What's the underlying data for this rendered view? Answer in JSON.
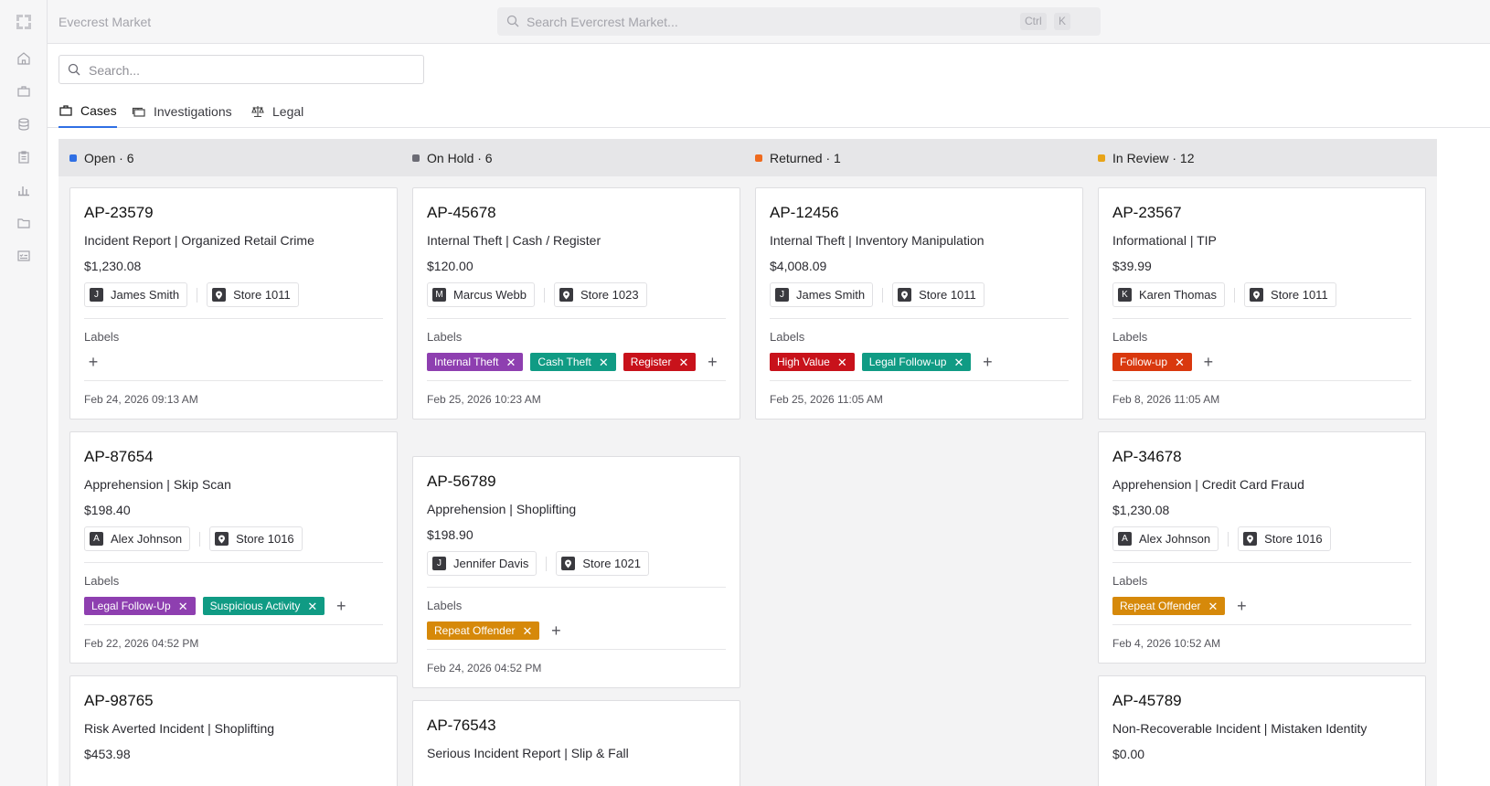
{
  "app": {
    "brand": "Evecrest Market"
  },
  "global_search": {
    "placeholder": "Search Evercrest Market...",
    "key1": "Ctrl",
    "key2": "K"
  },
  "local_search": {
    "placeholder": "Search..."
  },
  "tabs": [
    {
      "label": "Cases",
      "icon": "briefcase-icon"
    },
    {
      "label": "Investigations",
      "icon": "stack-briefcase-icon"
    },
    {
      "label": "Legal",
      "icon": "scale-icon"
    }
  ],
  "labels_heading": "Labels",
  "colors": {
    "accent": "#2f6fe4",
    "open": "#2f6fe4",
    "on_hold": "#6b6b74",
    "returned": "#ef6a1e",
    "in_review": "#e8a418"
  },
  "columns": [
    {
      "title": "Open · 6",
      "cards": [
        {
          "id": "AP-23579",
          "title": "Incident Report | Organized Retail Crime",
          "amount": "$1,230.08",
          "user_initial": "J",
          "user": "James Smith",
          "store": "Store 1011",
          "labels": [],
          "date": "Feb 24, 2026 09:13 AM"
        },
        {
          "id": "AP-87654",
          "title": "Apprehension | Skip Scan",
          "amount": "$198.40",
          "user_initial": "A",
          "user": "Alex Johnson",
          "store": "Store 1016",
          "labels": [
            {
              "text": "Legal Follow-Up",
              "color": "#8e3fb0"
            },
            {
              "text": "Suspicious Activity",
              "color": "#109b84"
            }
          ],
          "date": "Feb 22, 2026 04:52 PM"
        },
        {
          "id": "AP-98765",
          "title": "Risk Averted Incident | Shoplifting",
          "amount": "$453.98"
        }
      ]
    },
    {
      "title": "On Hold · 6",
      "cards": [
        {
          "id": "AP-45678",
          "title": "Internal Theft | Cash / Register",
          "amount": "$120.00",
          "user_initial": "M",
          "user": "Marcus Webb",
          "store": "Store 1023",
          "labels": [
            {
              "text": "Internal Theft",
              "color": "#8e3fb0"
            },
            {
              "text": "Cash Theft",
              "color": "#109b84"
            },
            {
              "text": "Register",
              "color": "#c8121b"
            }
          ],
          "wrap_plus": true,
          "date": "Feb 25, 2026 10:23 AM"
        },
        {
          "id": "AP-56789",
          "title": "Apprehension | Shoplifting",
          "amount": "$198.90",
          "user_initial": "J",
          "user": "Jennifer Davis",
          "store": "Store 1021",
          "labels": [
            {
              "text": "Repeat Offender",
              "color": "#d6890a"
            }
          ],
          "date": "Feb 24, 2026 04:52 PM"
        },
        {
          "id": "AP-76543",
          "title": "Serious Incident Report | Slip & Fall"
        }
      ]
    },
    {
      "title": "Returned · 1",
      "cards": [
        {
          "id": "AP-12456",
          "title": "Internal Theft | Inventory Manipulation",
          "amount": "$4,008.09",
          "user_initial": "J",
          "user": "James Smith",
          "store": "Store 1011",
          "labels": [
            {
              "text": "High Value",
              "color": "#c8121b"
            },
            {
              "text": "Legal Follow-up",
              "color": "#109b84"
            }
          ],
          "date": "Feb 25, 2026 11:05 AM"
        }
      ]
    },
    {
      "title": "In Review · 12",
      "cards": [
        {
          "id": "AP-23567",
          "title": "Informational | TIP",
          "amount": "$39.99",
          "user_initial": "K",
          "user": "Karen Thomas",
          "store": "Store 1011",
          "labels": [
            {
              "text": "Follow-up",
              "color": "#d9380e"
            }
          ],
          "date": "Feb 8, 2026 11:05 AM"
        },
        {
          "id": "AP-34678",
          "title": "Apprehension | Credit Card Fraud",
          "amount": "$1,230.08",
          "user_initial": "A",
          "user": "Alex Johnson",
          "store": "Store 1016",
          "labels": [
            {
              "text": "Repeat Offender",
              "color": "#d6890a"
            }
          ],
          "date": "Feb 4, 2026 10:52 AM"
        },
        {
          "id": "AP-45789",
          "title": "Non-Recoverable Incident | Mistaken Identity",
          "amount": "$0.00"
        }
      ]
    }
  ]
}
